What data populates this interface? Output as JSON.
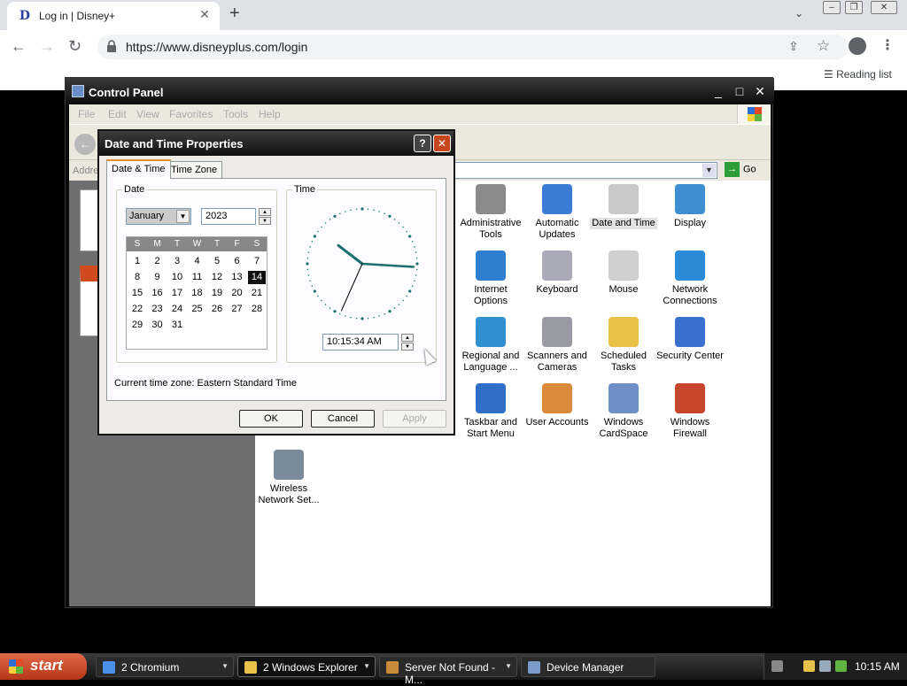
{
  "browser": {
    "tab_title": "Log in | Disney+",
    "tab_favicon": "disney-plus-logo",
    "url": "https://www.disneyplus.com/login",
    "reading_list": "Reading list"
  },
  "control_panel": {
    "title": "Control Panel",
    "menu": [
      "File",
      "Edit",
      "View",
      "Favorites",
      "Tools",
      "Help"
    ],
    "address_label": "Address",
    "go_label": "Go",
    "items": [
      {
        "label": "Administrative Tools",
        "icon": "admin-tools-icon",
        "color": "#8a8a8a"
      },
      {
        "label": "Automatic Updates",
        "icon": "windows-update-icon",
        "color": "#3a7bd5"
      },
      {
        "label": "Date and Time",
        "icon": "date-time-icon",
        "color": "#c9c9c9",
        "selected": true
      },
      {
        "label": "Display",
        "icon": "display-icon",
        "color": "#3d8fd1"
      },
      {
        "label": "Internet Options",
        "icon": "internet-options-icon",
        "color": "#2f7fd0"
      },
      {
        "label": "Keyboard",
        "icon": "keyboard-icon",
        "color": "#a9a9b8"
      },
      {
        "label": "Mouse",
        "icon": "mouse-icon",
        "color": "#d0d0d0"
      },
      {
        "label": "Network Connections",
        "icon": "network-connections-icon",
        "color": "#2c8bd6"
      },
      {
        "label": "Regional and Language ...",
        "icon": "regional-language-icon",
        "color": "#2f8fcf"
      },
      {
        "label": "Scanners and Cameras",
        "icon": "scanner-camera-icon",
        "color": "#9a9aa5"
      },
      {
        "label": "Scheduled Tasks",
        "icon": "scheduled-tasks-icon",
        "color": "#e8c14a"
      },
      {
        "label": "Security Center",
        "icon": "security-center-icon",
        "color": "#3a6fd0"
      },
      {
        "label": "Taskbar and Start Menu",
        "icon": "taskbar-start-icon",
        "color": "#2f6fc8"
      },
      {
        "label": "User Accounts",
        "icon": "user-accounts-icon",
        "color": "#d98a3a"
      },
      {
        "label": "Windows CardSpace",
        "icon": "cardspace-icon",
        "color": "#6f8fc9"
      },
      {
        "label": "Windows Firewall",
        "icon": "firewall-icon",
        "color": "#c6462b"
      },
      {
        "label": "Wireless Network Set...",
        "icon": "wireless-network-icon",
        "color": "#7a8a9a"
      }
    ]
  },
  "dialog": {
    "title": "Date and Time Properties",
    "tabs": [
      "Date & Time",
      "Time Zone"
    ],
    "date_group": "Date",
    "time_group": "Time",
    "month": "January",
    "year": "2023",
    "weekday_headers": [
      "S",
      "M",
      "T",
      "W",
      "T",
      "F",
      "S"
    ],
    "days": [
      "1",
      "2",
      "3",
      "4",
      "5",
      "6",
      "7",
      "8",
      "9",
      "10",
      "11",
      "12",
      "13",
      "14",
      "15",
      "16",
      "17",
      "18",
      "19",
      "20",
      "21",
      "22",
      "23",
      "24",
      "25",
      "26",
      "27",
      "28",
      "29",
      "30",
      "31"
    ],
    "first_day_offset": 0,
    "selected_day": "14",
    "time": "10:15:34 AM",
    "time_zone_text": "Current time zone:  Eastern Standard Time",
    "buttons": {
      "ok": "OK",
      "cancel": "Cancel",
      "apply": "Apply"
    }
  },
  "taskbar": {
    "start": "start",
    "buttons": [
      {
        "label": "2 Chromium",
        "icon": "chromium-icon",
        "color": "#4a8fe8",
        "active": false
      },
      {
        "label": "2 Windows Explorer",
        "icon": "folder-icon",
        "color": "#e8c14a",
        "active": true
      },
      {
        "label": "Server Not Found - M...",
        "icon": "firefox-icon",
        "color": "#c98a3a",
        "active": false
      },
      {
        "label": "Device Manager",
        "icon": "device-manager-icon",
        "color": "#7a9ac9",
        "active": false
      }
    ],
    "clock": "10:15 AM"
  }
}
